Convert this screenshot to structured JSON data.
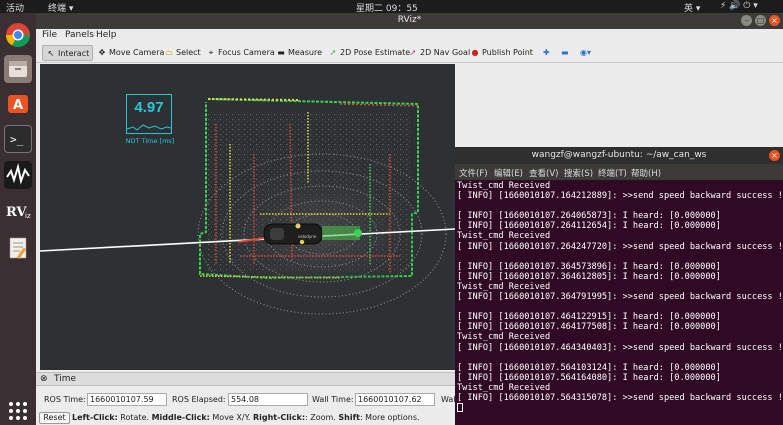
{
  "topbar": {
    "activities": "活动",
    "app_menu": "终端 ▾",
    "clock": "星期二 09：55",
    "input_method": "英 ▾",
    "status_icons": "⚡ 🔊 ⏻ ▾"
  },
  "dock": {
    "items": [
      "chrome",
      "files",
      "software",
      "terminal",
      "waveform-app",
      "rviz",
      "text-editor",
      "show-apps"
    ]
  },
  "rviz": {
    "title": "RViz*",
    "menu": [
      "File",
      "Panels",
      "Help"
    ],
    "toolbar": [
      "Interact",
      "Move Camera",
      "Select",
      "Focus Camera",
      "Measure",
      "2D Pose Estimate",
      "2D Nav Goal",
      "Publish Point"
    ],
    "overlay": {
      "value": "4.97",
      "label": "NDT Time [ms]"
    },
    "time_panel": {
      "header": "Time",
      "ros_time_label": "ROS Time:",
      "ros_time_value": "1660010107.59",
      "ros_elapsed_label": "ROS Elapsed:",
      "ros_elapsed_value": "554.08",
      "wall_time_label": "Wall Time:",
      "wall_time_value": "1660010107.62",
      "wall_elapsed_label_partial": "Wal",
      "reset_button": "Reset",
      "hint_left_click": "Left-Click:",
      "hint_left_click_text": " Rotate. ",
      "hint_middle_click": "Middle-Click:",
      "hint_middle_click_text": " Move X/Y. ",
      "hint_right_click": "Right-Click:",
      "hint_right_click_text": ": Zoom. ",
      "hint_shift": "Shift",
      "hint_shift_text": ": More options."
    }
  },
  "terminal": {
    "title": "wangzf@wangzf-ubuntu: ~/aw_can_ws",
    "menu": [
      "文件(F)",
      "编辑(E)",
      "查看(V)",
      "搜索(S)",
      "终端(T)",
      "帮助(H)"
    ],
    "lines": [
      "Twist_cmd Received",
      "[ INFO] [1660010107.164212889]: >>send speed backward success !",
      "",
      "[ INFO] [1660010107.264065873]: I heard: [0.000000]",
      "[ INFO] [1660010107.264112654]: I heard: [0.000000]",
      "Twist_cmd Received",
      "[ INFO] [1660010107.264247720]: >>send speed backward success !",
      "",
      "[ INFO] [1660010107.364573896]: I heard: [0.000000]",
      "[ INFO] [1660010107.364612805]: I heard: [0.000000]",
      "Twist_cmd Received",
      "[ INFO] [1660010107.364791995]: >>send speed backward success !",
      "",
      "[ INFO] [1660010107.464122915]: I heard: [0.000000]",
      "[ INFO] [1660010107.464177508]: I heard: [0.000000]",
      "Twist_cmd Received",
      "[ INFO] [1660010107.464340403]: >>send speed backward success !",
      "",
      "[ INFO] [1660010107.564103124]: I heard: [0.000000]",
      "[ INFO] [1660010107.564164080]: I heard: [0.000000]",
      "Twist_cmd Received",
      "[ INFO] [1660010107.564315078]: >>send speed backward success !",
      ""
    ],
    "cursor_color": "#ffffff"
  },
  "colors": {
    "terminal_bg": "#300a24",
    "overlay_cyan": "#26c6da",
    "lidar_green": "#39d353",
    "lidar_red": "#d84a3a",
    "lidar_yellow": "#e8d44d"
  }
}
